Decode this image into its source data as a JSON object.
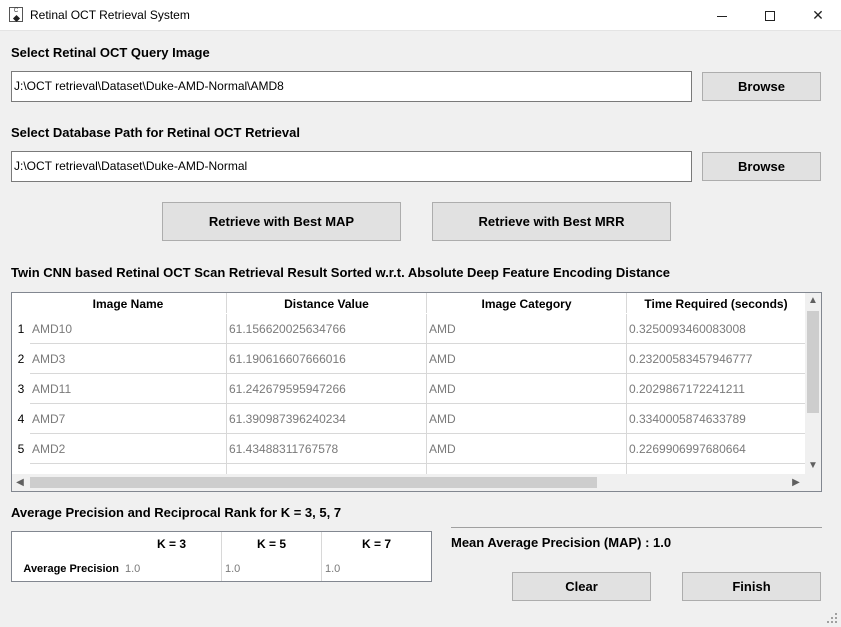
{
  "window": {
    "title": "Retinal OCT Retrieval System"
  },
  "query": {
    "label": "Select Retinal OCT Query Image",
    "path": "J:\\OCT retrieval\\Dataset\\Duke-AMD-Normal\\AMD8",
    "browse_label": "Browse"
  },
  "database": {
    "label": "Select Database Path for Retinal OCT Retrieval",
    "path": "J:\\OCT retrieval\\Dataset\\Duke-AMD-Normal",
    "browse_label": "Browse"
  },
  "actions": {
    "best_map_label": "Retrieve with Best MAP",
    "best_mrr_label": "Retrieve with Best MRR",
    "clear_label": "Clear",
    "finish_label": "Finish"
  },
  "results": {
    "heading": "Twin CNN based Retinal OCT Scan Retrieval Result Sorted w.r.t. Absolute Deep Feature Encoding Distance",
    "columns": [
      "Image Name",
      "Distance Value",
      "Image Category",
      "Time Required (seconds)"
    ],
    "rows": [
      {
        "num": "1",
        "name": "AMD10",
        "distance": "61.156620025634766",
        "category": "AMD",
        "time": "0.3250093460083008"
      },
      {
        "num": "2",
        "name": "AMD3",
        "distance": "61.190616607666016",
        "category": "AMD",
        "time": "0.23200583457946777"
      },
      {
        "num": "3",
        "name": "AMD11",
        "distance": "61.242679595947266",
        "category": "AMD",
        "time": "0.2029867172241211"
      },
      {
        "num": "4",
        "name": "AMD7",
        "distance": "61.390987396240234",
        "category": "AMD",
        "time": "0.3340005874633789"
      },
      {
        "num": "5",
        "name": "AMD2",
        "distance": "61.43488311767578",
        "category": "AMD",
        "time": "0.2269906997680664"
      }
    ]
  },
  "precision": {
    "heading": "Average Precision and Reciprocal Rank for K = 3, 5, 7",
    "columns": [
      "K = 3",
      "K = 5",
      "K = 7"
    ],
    "row_label": "Average Precision",
    "values": [
      "1.0",
      "1.0",
      "1.0"
    ]
  },
  "map": {
    "text": "Mean Average Precision (MAP) : 1.0"
  }
}
